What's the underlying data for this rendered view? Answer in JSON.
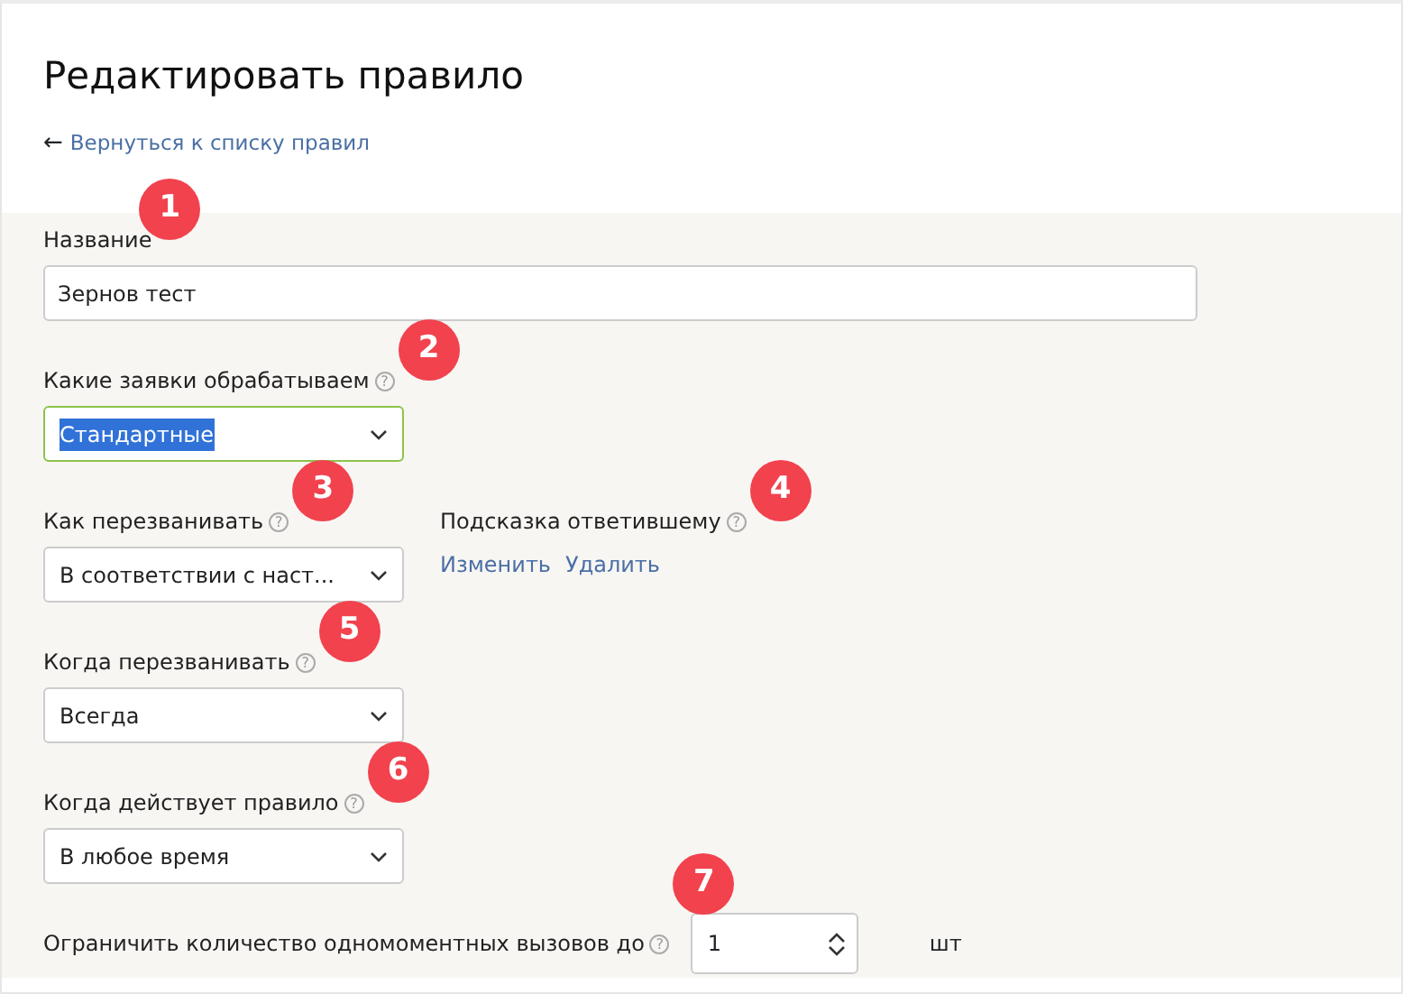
{
  "title": "Редактировать правило",
  "back_link": {
    "icon": "←",
    "label": "Вернуться к списку правил"
  },
  "fields": [
    {
      "kind": "text",
      "label": "Название",
      "value": "Зернов тест",
      "badge": "1"
    },
    {
      "kind": "select",
      "label": "Какие заявки обрабатываем",
      "value": "Стандартные",
      "help": "?",
      "focused": true,
      "badge": "2"
    },
    {
      "kind": "pair",
      "items": [
        {
          "kind": "select",
          "label": "Как перезванивать",
          "value": "В соответствии с наст...",
          "help": "?",
          "focused": false,
          "badge": "3"
        },
        {
          "kind": "links",
          "label": "Подсказка ответившему",
          "help": "?",
          "links": [
            "Изменить",
            "Удалить"
          ],
          "badge": "4"
        }
      ]
    },
    {
      "kind": "select",
      "label": "Когда перезванивать",
      "value": "Всегда",
      "help": "?",
      "focused": false,
      "badge": "5"
    },
    {
      "kind": "select",
      "label": "Когда действует правило",
      "value": "В любое время",
      "help": "?",
      "focused": false,
      "badge": "6"
    },
    {
      "kind": "number",
      "label": "Ограничить количество одномоментных вызовов до",
      "value": "1",
      "unit": "шт",
      "help": "?",
      "badge": "7"
    }
  ]
}
